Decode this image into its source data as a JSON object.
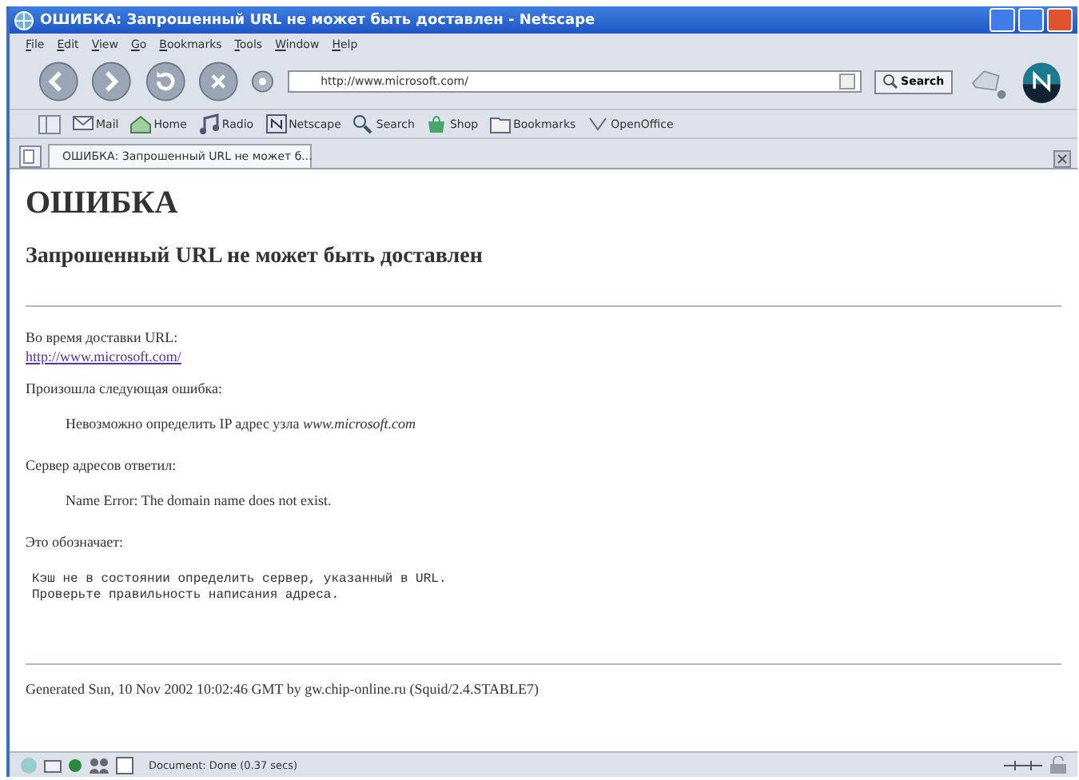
{
  "window": {
    "title": "ОШИБКА: Запрошенный URL не может быть доставлен - Netscape"
  },
  "menu": [
    "File",
    "Edit",
    "View",
    "Go",
    "Bookmarks",
    "Tools",
    "Window",
    "Help"
  ],
  "navigation": {
    "url": "http://www.microsoft.com/",
    "search_button": "Search"
  },
  "personal_toolbar": [
    "Mail",
    "Home",
    "Radio",
    "Netscape",
    "Search",
    "Shop",
    "Bookmarks",
    "OpenOffice"
  ],
  "tabs": [
    {
      "label": "ОШИБКА: Запрошенный URL не может б...",
      "selected": true
    }
  ],
  "page": {
    "heading": "ОШИБКА",
    "subheading": "Запрошенный URL не может быть доставлен",
    "blocks": [
      {
        "kind": "text",
        "text": "Во время доставки URL:"
      },
      {
        "kind": "link",
        "text": "http://www.microsoft.com/"
      },
      {
        "kind": "para",
        "text": "Произошла следующая ошибка:"
      },
      {
        "kind": "indent",
        "text": "Невозможно определить IP адрес узла *www.microsoft.com*"
      },
      {
        "kind": "para",
        "text": "Сервер адресов ответил:"
      },
      {
        "kind": "indent",
        "text": "Name Error: The domain name does not exist."
      },
      {
        "kind": "para",
        "text": "Это обозначает:"
      },
      {
        "kind": "pre",
        "text": "Кэш не в состоянии определить сервер, указанный в URL.\nПроверьте правильность написания адреса."
      }
    ],
    "footer": "Generated Sun, 10 Nov 2002 10:02:46 GMT by gw.chip-online.ru (Squid/2.4.STABLE7)"
  },
  "status_bar": {
    "text": "Document: Done (0.37 secs)"
  }
}
